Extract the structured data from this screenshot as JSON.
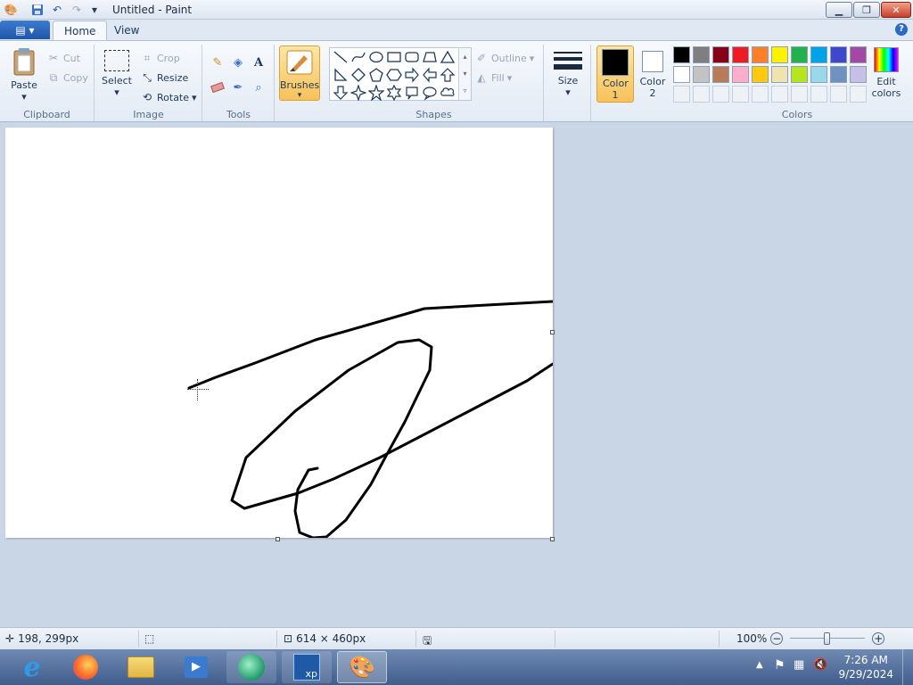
{
  "window": {
    "title": "Untitled - Paint"
  },
  "tabs": [
    "Home",
    "View"
  ],
  "ribbon": {
    "clipboard": {
      "label": "Clipboard",
      "paste": "Paste",
      "cut": "Cut",
      "copy": "Copy"
    },
    "image": {
      "label": "Image",
      "select": "Select",
      "crop": "Crop",
      "resize": "Resize",
      "rotate": "Rotate"
    },
    "tools": {
      "label": "Tools"
    },
    "brushes": {
      "label": "Brushes"
    },
    "shapes": {
      "label": "Shapes",
      "outline": "Outline",
      "fill": "Fill"
    },
    "size": {
      "label": "Size"
    },
    "colors": {
      "label": "Colors",
      "color1_label": "Color 1",
      "color2_label": "Color 2",
      "edit_label": "Edit colors",
      "color1_value": "#000000",
      "color2_value": "#ffffff",
      "palette_row1": [
        "#000000",
        "#7f7f7f",
        "#880015",
        "#ed1c24",
        "#ff7f27",
        "#fff200",
        "#22b14c",
        "#00a2e8",
        "#3f48cc",
        "#a349a4"
      ],
      "palette_row2": [
        "#ffffff",
        "#c3c3c3",
        "#b97a57",
        "#ffaec9",
        "#ffc90e",
        "#efe4b0",
        "#b5e61d",
        "#99d9ea",
        "#7092be",
        "#c8bfe7"
      ]
    }
  },
  "status": {
    "cursor_pos": "198, 299px",
    "canvas_size": "614 × 460px",
    "zoom": "100%"
  },
  "taskbar": {
    "time": "7:26 AM",
    "date": "9/29/2024"
  }
}
